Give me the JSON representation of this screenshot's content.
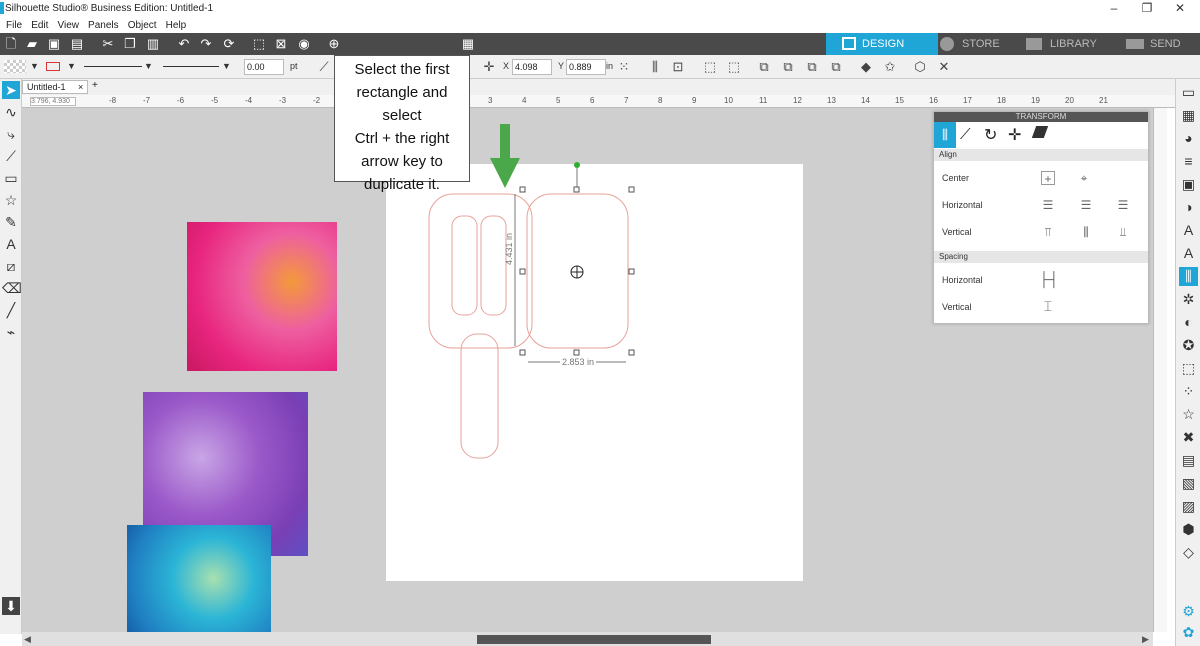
{
  "window": {
    "title": "Silhouette Studio® Business Edition: Untitled-1",
    "minimize": "–",
    "maximize": "❐",
    "close": "✕"
  },
  "menu": [
    "File",
    "Edit",
    "View",
    "Panels",
    "Object",
    "Help"
  ],
  "nav_tabs": {
    "design": "DESIGN",
    "store": "STORE",
    "library": "LIBRARY",
    "send": "SEND"
  },
  "toolbar2": {
    "line_weight": "0.00",
    "unit_pt": "pt",
    "x_label": "X",
    "x_value": "4.098",
    "y_label": "Y",
    "y_value": "0.889",
    "unit_in": "in"
  },
  "doc_tab": {
    "label": "Untitled-1",
    "close": "×",
    "add": "+"
  },
  "ruler": {
    "coords": "3.796, 4.930",
    "ticks": [
      "-8",
      "-7",
      "-6",
      "-5",
      "-4",
      "-3",
      "-2",
      "3",
      "4",
      "5",
      "6",
      "7",
      "8",
      "9",
      "10",
      "11",
      "12",
      "13",
      "14",
      "15",
      "16",
      "17",
      "18",
      "19",
      "20",
      "21"
    ]
  },
  "dimensions": {
    "height": "4.431 in",
    "width": "2.853 in"
  },
  "callout": {
    "lines": [
      "Select the first",
      "rectangle and select",
      "Ctrl + the right",
      "arrow key to",
      "duplicate it."
    ]
  },
  "transform_panel": {
    "title": "TRANSFORM",
    "align_section": "Align",
    "center_label": "Center",
    "horizontal_label": "Horizontal",
    "vertical_label": "Vertical",
    "spacing_section": "Spacing",
    "spacing_horizontal_label": "Horizontal",
    "spacing_vertical_label": "Vertical"
  },
  "colors": {
    "accent": "#1fa5d6",
    "toolbar_dark": "#4a4a4a",
    "shape_stroke": "#e8a29a",
    "arrow_green": "#4aa84a",
    "canvas_bg": "#cfcfcf"
  }
}
